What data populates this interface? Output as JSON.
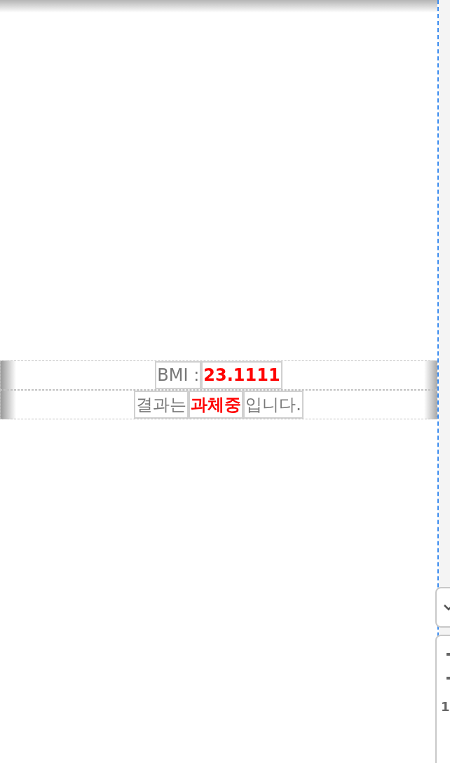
{
  "result_rows": [
    {
      "cells": [
        {
          "text": "BMI :",
          "kind": "label"
        },
        {
          "text": "23.1111",
          "kind": "highlight"
        }
      ]
    },
    {
      "cells": [
        {
          "text": "결과는",
          "kind": "label"
        },
        {
          "text": "과체중",
          "kind": "highlight"
        },
        {
          "text": "입니다.",
          "kind": "label"
        }
      ]
    }
  ],
  "side_panel": {
    "text": "1"
  }
}
